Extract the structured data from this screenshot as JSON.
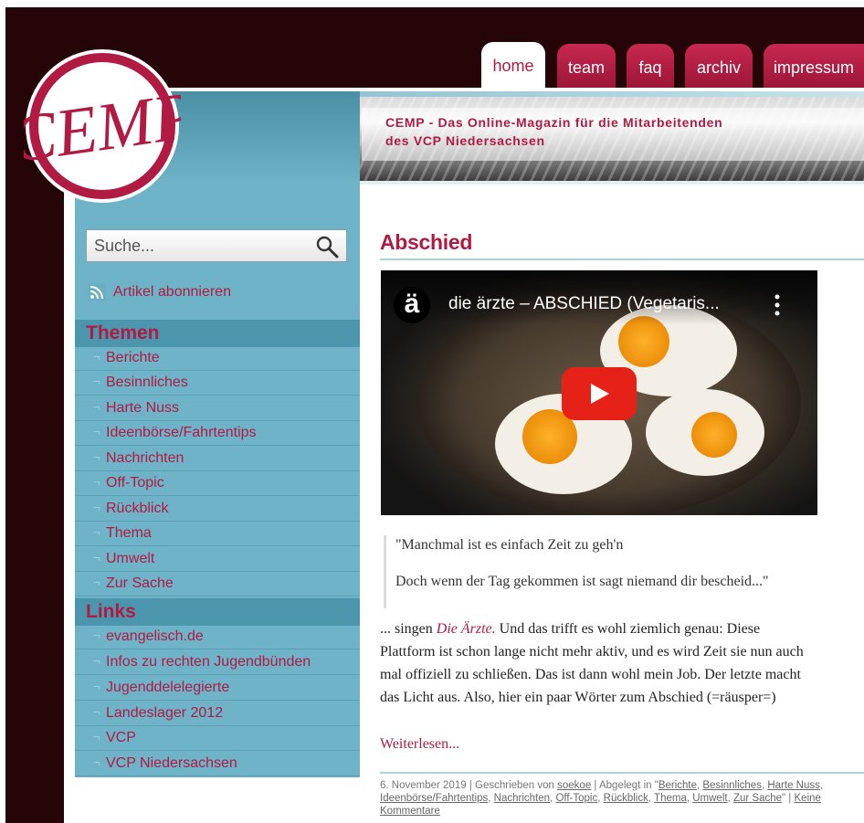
{
  "nav": {
    "tabs": [
      {
        "label": "home",
        "active": true
      },
      {
        "label": "team",
        "active": false
      },
      {
        "label": "faq",
        "active": false
      },
      {
        "label": "archiv",
        "active": false
      },
      {
        "label": "impressum",
        "active": false
      }
    ]
  },
  "header": {
    "logo_text": "CEMP",
    "tagline_line1": "CEMP - Das Online-Magazin für die Mitarbeitenden",
    "tagline_line2": "des VCP Niedersachsen"
  },
  "sidebar": {
    "search_placeholder": "Suche...",
    "subscribe_label": "Artikel abonnieren",
    "themes_heading": "Themen",
    "themes": [
      "Berichte",
      "Besinnliches",
      "Harte Nuss",
      "Ideenbörse/Fahrtentips",
      "Nachrichten",
      "Off-Topic",
      "Rückblick",
      "Thema",
      "Umwelt",
      "Zur Sache"
    ],
    "links_heading": "Links",
    "links": [
      "evangelisch.de",
      "Infos zu rechten Jugendbünden",
      "Jugenddelelegierte",
      "Landeslager 2012",
      "VCP",
      "VCP Niedersachsen"
    ],
    "bullet": "¬"
  },
  "post": {
    "title": "Abschied",
    "video": {
      "channel_letter": "ä",
      "title": "die ärzte – ABSCHIED (Vegetaris..."
    },
    "quote": [
      "\"Manchmal ist es einfach Zeit zu geh'n",
      "Doch wenn der Tag gekommen ist sagt niemand dir bescheid...\""
    ],
    "body": {
      "line1_pre": "... singen ",
      "line1_em": "Die Ärzte.",
      "line1_post": " Und das trifft es wohl ziemlich genau: Diese",
      "line2": "Plattform ist schon lange nicht mehr aktiv, und es wird Zeit sie nun auch",
      "line3": "mal offiziell zu schließen. Das ist dann wohl mein Job. Der letzte macht",
      "line4": "das Licht aus. Also, hier ein paar Wörter zum Abschied (=räusper=)"
    },
    "read_more": "Weiterlesen...",
    "meta": {
      "date": "6. November 2019",
      "written_by": " | Geschrieben von ",
      "author": "soekoe",
      "filed_in": " | Abgelegt in \"",
      "categories": [
        "Berichte",
        "Besinnliches",
        "Harte Nuss",
        "Ideenbörse/Fahrtentips",
        "Nachrichten",
        "Off-Topic",
        "Rückblick",
        "Thema",
        "Umwelt",
        "Zur Sache"
      ],
      "sep": ", ",
      "close": "\" | ",
      "comments": "Keine Kommentare"
    }
  },
  "colors": {
    "brand": "#b11a42",
    "sidebar": "#6fb3c8",
    "background_dark": "#260509"
  }
}
